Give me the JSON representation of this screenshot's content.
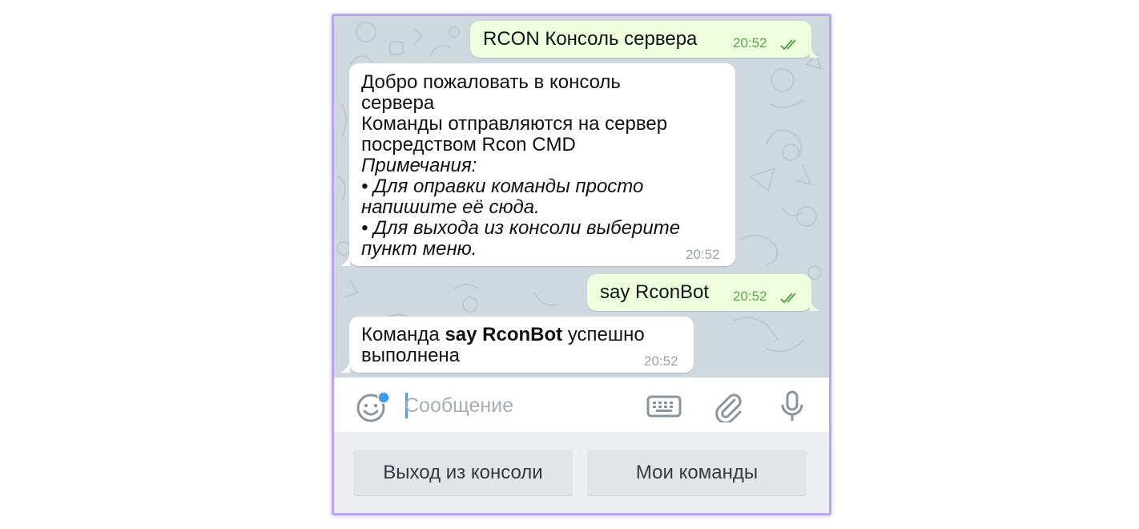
{
  "messages": {
    "m1": {
      "text": "RCON Консоль сервера",
      "time": "20:52"
    },
    "m2": {
      "line1": "Добро пожаловать в консоль",
      "line2": "сервера",
      "line3": "Команды отправляются на сервер",
      "line4": "посредством Rcon CMD",
      "line5": "Примечания:",
      "line6": "• Для оправки команды просто",
      "line7": "напишите её сюда.",
      "line8": "• Для выхода из консоли выберите",
      "line9": "пункт меню.",
      "time": "20:52"
    },
    "m3": {
      "text": "say RconBot",
      "time": "20:52"
    },
    "m4": {
      "prefix": "Команда ",
      "bold": "say RconBot",
      "suffix": " успешно",
      "line2": "выполнена",
      "time": "20:52"
    }
  },
  "input": {
    "placeholder": "Сообщение"
  },
  "keyboard": {
    "button1": "Выход из консоли",
    "button2": "Мои команды"
  },
  "colors": {
    "outgoing_bubble": "#efffde",
    "incoming_bubble": "#ffffff",
    "chat_background": "#cfd8df",
    "frame_border": "#b9a6ee",
    "read_check": "#5ea251",
    "notification_dot": "#3d9be9"
  },
  "icons": [
    "emoji-icon",
    "keyboard-icon",
    "attach-icon",
    "microphone-icon",
    "double-check-icon"
  ]
}
